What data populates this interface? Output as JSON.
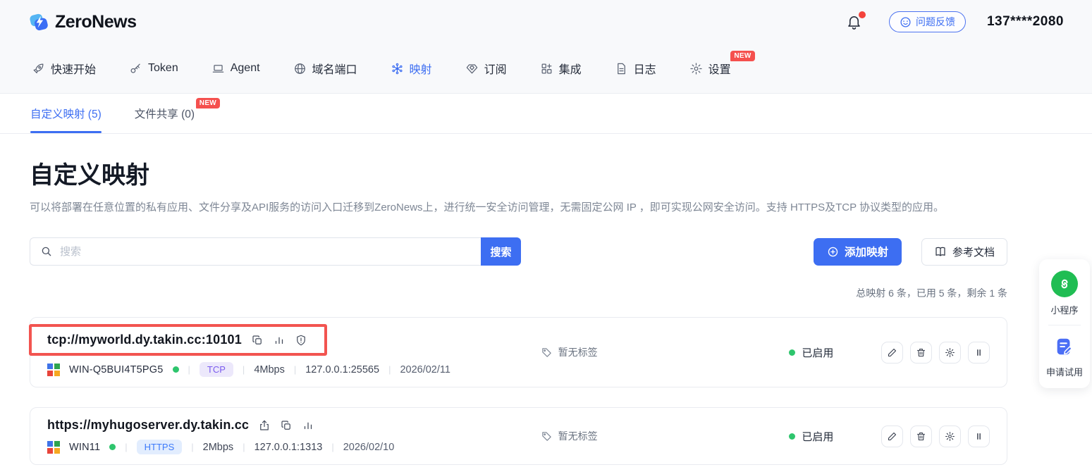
{
  "header": {
    "logo_text": "ZeroNews",
    "feedback_label": "问题反馈",
    "phone": "137****2080"
  },
  "nav": {
    "items": [
      {
        "label": "快速开始",
        "icon": "rocket-icon"
      },
      {
        "label": "Token",
        "icon": "key-icon"
      },
      {
        "label": "Agent",
        "icon": "laptop-icon"
      },
      {
        "label": "域名端口",
        "icon": "globe-icon"
      },
      {
        "label": "映射",
        "icon": "cluster-icon",
        "active": true
      },
      {
        "label": "订阅",
        "icon": "gem-icon"
      },
      {
        "label": "集成",
        "icon": "grid-plus-icon"
      },
      {
        "label": "日志",
        "icon": "document-icon"
      },
      {
        "label": "设置",
        "icon": "gear-icon",
        "badge": "NEW"
      }
    ]
  },
  "tabs": [
    {
      "label": "自定义映射 (5)",
      "active": true
    },
    {
      "label": "文件共享 (0)",
      "badge": "NEW"
    }
  ],
  "page": {
    "title": "自定义映射",
    "description": "可以将部署在任意位置的私有应用、文件分享及API服务的访问入口迁移到ZeroNews上，进行统一安全访问管理，无需固定公网 IP ，即可实现公网安全访问。支持 HTTPS及TCP 协议类型的应用。"
  },
  "toolbar": {
    "search_placeholder": "搜索",
    "search_button": "搜索",
    "add_button": "添加映射",
    "docs_button": "参考文档",
    "quota_text": "总映射 6 条，已用 5 条，剩余 1 条"
  },
  "rows": [
    {
      "url": "tcp://myworld.dy.takin.cc:10101",
      "host": "WIN-Q5BUI4T5PG5",
      "protocol": "TCP",
      "bandwidth": "4Mbps",
      "address": "127.0.0.1:25565",
      "date": "2026/02/11",
      "tag": "暂无标签",
      "status": "已启用"
    },
    {
      "url": "https://myhugoserver.dy.takin.cc",
      "host": "WIN11",
      "protocol": "HTTPS",
      "bandwidth": "2Mbps",
      "address": "127.0.0.1:1313",
      "date": "2026/02/10",
      "tag": "暂无标签",
      "status": "已启用"
    }
  ],
  "side_panel": {
    "miniprogram_label": "小程序",
    "trial_label": "申请试用"
  },
  "colors": {
    "primary_blue": "#3d6ef2",
    "status_green": "#2ec56d",
    "annotation_red": "#f25450",
    "new_badge_red": "#f5504e",
    "tcp_badge_bg": "#ece8fb",
    "tcp_badge_text": "#7a5bee",
    "https_badge_bg": "#e2edfe",
    "https_badge_text": "#3e7bfa",
    "miniprogram_green": "#20bd53"
  }
}
